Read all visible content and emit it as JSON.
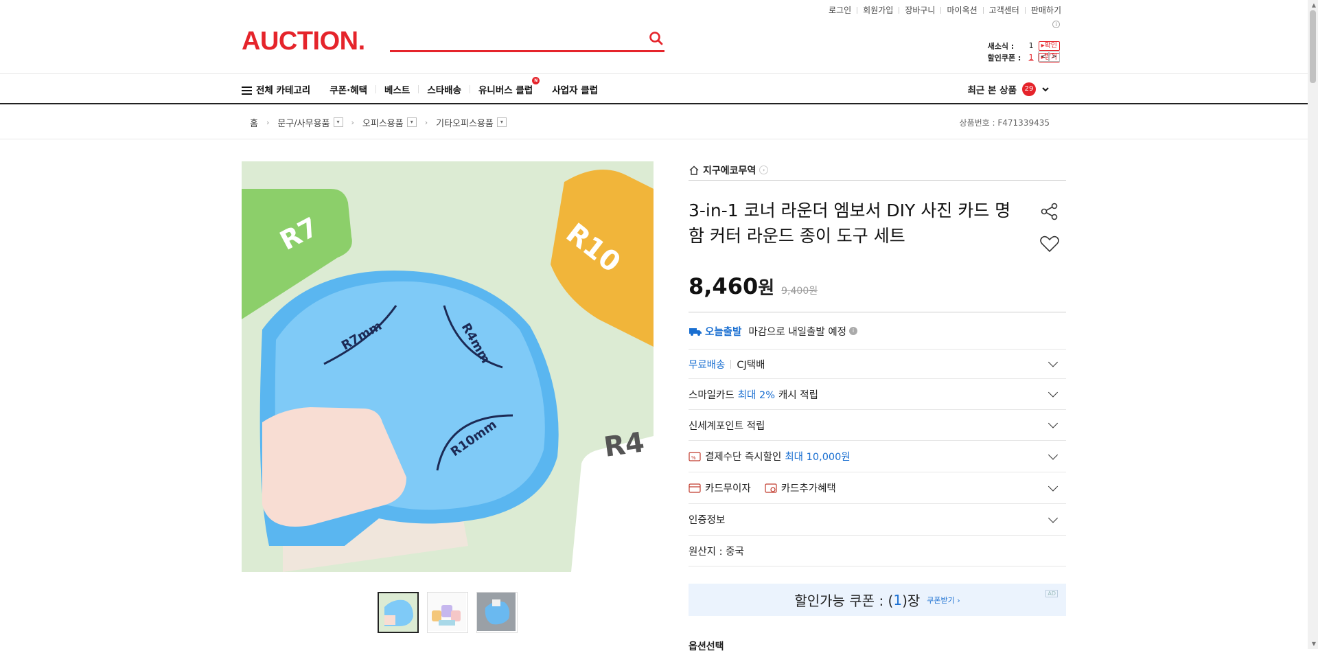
{
  "utility_nav": [
    "로그인",
    "회원가입",
    "장바구니",
    "마이옥션",
    "고객센터",
    "판매하기"
  ],
  "info_label": "i",
  "logo": "AUCTION.",
  "search": {
    "placeholder": ""
  },
  "side": {
    "news_label": "새소식 :",
    "news_count": "1",
    "news_btn": "▸확인",
    "coupon_label": "할인쿠폰 :",
    "coupon_count": "1",
    "coupon_btn": "▸받기",
    "prev": "<",
    "next": ">"
  },
  "nav": {
    "all_category": "전체 카테고리",
    "items": [
      "쿠폰·혜택",
      "베스트",
      "스타배송",
      "유니버스 클럽",
      "사업자 클럽"
    ],
    "new_mark": "N",
    "recent_label": "최근 본 상품",
    "recent_count": "29"
  },
  "breadcrumb": {
    "home": "홈",
    "levels": [
      "문구/사무용품",
      "오피스용품",
      "기타오피스용품"
    ],
    "product_no": "상품번호 : F471339435"
  },
  "image": {
    "labels": {
      "r7": "R7",
      "r10": "R10",
      "r4": "R4",
      "r7mm": "R7mm",
      "r4mm": "R4mm",
      "r10mm": "R10mm"
    }
  },
  "product": {
    "seller": "지구에코무역",
    "title": "3-in-1 코너 라운더 엠보서 DIY 사진 카드 명함 커터 라운드 종이 도구 세트",
    "price": "8,460",
    "currency": "원",
    "original_price": "9,400원"
  },
  "shipping": {
    "today_label": "오늘출발",
    "today_desc": "마감으로 내일출발 예정",
    "free_ship": "무료배송",
    "carrier": "CJ택배",
    "smile_prefix": "스마일카드",
    "smile_highlight": "최대 2%",
    "smile_suffix": "캐시 적립",
    "ssg_point": "신세계포인트 적립",
    "pay_prefix": "결제수단 즉시할인",
    "pay_highlight": "최대 10,000원",
    "card_interest": "카드무이자",
    "card_benefit": "카드추가혜택",
    "cert": "인증정보",
    "origin": "원산지 : 중국"
  },
  "coupon": {
    "prefix": "할인가능 쿠폰 : (",
    "count": "1",
    "suffix": ")장",
    "get": "쿠폰받기 ›",
    "ad": "AD"
  },
  "option_title": "옵션선택",
  "colors": {
    "brand": "#e5242b",
    "accent_blue": "#1a6fd1"
  }
}
